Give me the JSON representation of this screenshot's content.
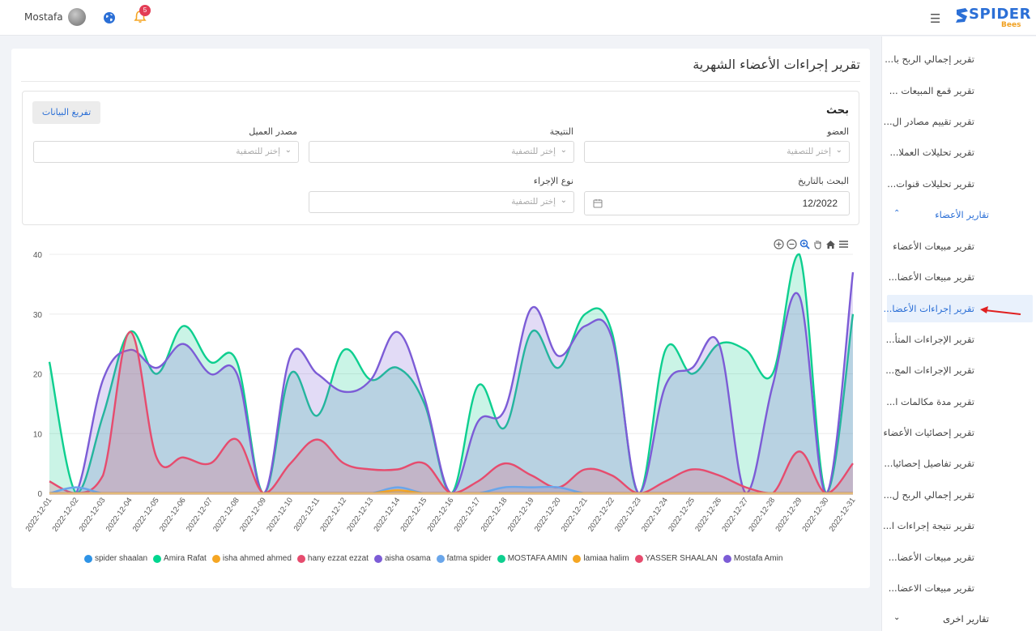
{
  "header": {
    "user_name": "Mostafa",
    "notification_count": "5",
    "logo_word": "SPIDER",
    "logo_sub": "Bees"
  },
  "sidebar": {
    "items_top": [
      "تقرير إجمالي الربح با...",
      "تقرير قمع المبيعات ...",
      "تقرير تقييم مصادر ال...",
      "تقرير تحليلات العملا...",
      "تقرير تحليلات قنوات..."
    ],
    "group_members": "تقارير الأعضاء",
    "items_members": [
      "تقرير مبيعات الأعضاء",
      "تقرير مبيعات الأعضا...",
      "تقرير إجراءات الأعضا...",
      "تقرير الإجراءات المتأ...",
      "تقرير الإجراءات المج...",
      "تقرير مدة مكالمات ا...",
      "تقرير إحصائيات الأعضاء",
      "تقرير تفاصيل إحصائيا...",
      "تقرير إجمالي الربح ل...",
      "تقرير نتيجة إجراءات ا...",
      "تقرير مبيعات الأعضا...",
      "تقرير مبيعات الاعضا..."
    ],
    "active_index": 2,
    "group_other": "تقارير اخرى"
  },
  "page": {
    "title": "تقرير إجراءات الأعضاء الشهرية",
    "search_title": "بحث",
    "export_label": "تفريغ البيانات",
    "filters": {
      "member_label": "العضو",
      "result_label": "النتيجة",
      "source_label": "مصدر العميل",
      "date_label": "البحث بالتاريخ",
      "action_type_label": "نوع الإجراء",
      "placeholder": "إختر للتصفية",
      "date_value": "12/2022"
    }
  },
  "colors": {
    "accent": "#2b6fd6",
    "mostafa_amin": "#7c5cd6",
    "mostafa_amin_upper": "#0ecf8f",
    "hany": "#e64c6e",
    "fatma": "#6aa6ea"
  },
  "chart_data": {
    "type": "area",
    "x": [
      "2022-12-01",
      "2022-12-02",
      "2022-12-03",
      "2022-12-04",
      "2022-12-05",
      "2022-12-06",
      "2022-12-07",
      "2022-12-08",
      "2022-12-09",
      "2022-12-10",
      "2022-12-11",
      "2022-12-12",
      "2022-12-13",
      "2022-12-14",
      "2022-12-15",
      "2022-12-16",
      "2022-12-17",
      "2022-12-18",
      "2022-12-19",
      "2022-12-20",
      "2022-12-21",
      "2022-12-22",
      "2022-12-23",
      "2022-12-24",
      "2022-12-25",
      "2022-12-26",
      "2022-12-27",
      "2022-12-28",
      "2022-12-29",
      "2022-12-30",
      "2022-12-31"
    ],
    "ylim": [
      0,
      40
    ],
    "yticks": [
      0,
      10,
      20,
      30,
      40
    ],
    "grid": true,
    "legend_position": "bottom",
    "series": [
      {
        "name": "spider shaalan",
        "color": "#2e93e6",
        "values": [
          0,
          0,
          0,
          0,
          0,
          0,
          0,
          0,
          0,
          0,
          0,
          0,
          0,
          0,
          0,
          0,
          0,
          0,
          0,
          0,
          0,
          0,
          0,
          0,
          0,
          0,
          0,
          0,
          0,
          0,
          0
        ]
      },
      {
        "name": "Amira Rafat",
        "color": "#00d68f",
        "values": [
          0,
          0,
          0,
          0,
          0,
          0,
          0,
          0,
          0,
          0,
          0,
          0,
          0,
          0,
          0,
          0,
          0,
          0,
          0,
          0,
          0,
          0,
          0,
          0,
          0,
          0,
          0,
          0,
          0,
          0,
          0
        ]
      },
      {
        "name": "isha ahmed ahmed",
        "color": "#f5a623",
        "values": [
          0,
          0,
          0,
          0,
          0,
          0,
          0,
          0,
          0,
          0,
          0,
          0,
          0,
          0.5,
          0,
          0,
          0,
          0,
          0,
          0,
          0,
          0,
          0,
          0,
          0,
          0,
          0,
          0,
          0,
          0,
          0
        ]
      },
      {
        "name": "hany ezzat ezzat",
        "color": "#e64c6e",
        "values": [
          0,
          0,
          0,
          0,
          0,
          0,
          0,
          0,
          0,
          0,
          0,
          0,
          0,
          0,
          0,
          0,
          0,
          0,
          0,
          0,
          0,
          0,
          0,
          0,
          0,
          0,
          0,
          0,
          0,
          0,
          0
        ]
      },
      {
        "name": "aisha osama",
        "color": "#7c5cd6",
        "values": [
          0,
          0,
          0,
          0,
          0,
          0,
          0,
          0,
          0,
          0,
          0,
          0,
          0,
          0,
          0,
          0,
          0,
          0,
          0,
          0,
          0,
          0,
          0,
          0,
          0,
          0,
          0,
          0,
          0,
          0,
          0
        ]
      },
      {
        "name": "fatma spider",
        "color": "#6aa6ea",
        "values": [
          0,
          1,
          0,
          0,
          0,
          0,
          0,
          0,
          0,
          0,
          0,
          0,
          0,
          1,
          0,
          0,
          0,
          1,
          1,
          1,
          0,
          0,
          0,
          0,
          0,
          0,
          0,
          0,
          0,
          0,
          0
        ]
      },
      {
        "name": "MOSTAFA AMIN",
        "color": "#0ecf8f",
        "values": [
          22,
          0,
          13,
          27,
          20,
          28,
          22,
          22,
          0,
          20,
          13,
          24,
          19,
          21,
          15,
          0,
          18,
          11,
          27,
          21,
          30,
          27,
          0,
          24,
          20,
          25,
          24,
          20,
          40,
          0,
          30
        ]
      },
      {
        "name": "lamiaa halim",
        "color": "#f5a623",
        "values": [
          0,
          0,
          0,
          0,
          0,
          0,
          0,
          0,
          0,
          0,
          0,
          0,
          0,
          0,
          0,
          0,
          0,
          0,
          0,
          0,
          0,
          0,
          0,
          0,
          0,
          0,
          0,
          0,
          0,
          0,
          0
        ]
      },
      {
        "name": "YASSER SHAALAN",
        "color": "#e64c6e",
        "values": [
          2,
          0,
          3,
          27,
          6,
          6,
          5,
          9,
          0,
          5,
          9,
          5,
          4,
          4,
          5,
          0,
          2,
          5,
          3,
          1,
          4,
          3,
          0,
          2,
          4,
          3,
          1,
          0,
          7,
          0,
          5
        ]
      },
      {
        "name": "Mostafa Amin",
        "color": "#7c5cd6",
        "values": [
          0,
          0,
          19,
          24,
          21,
          25,
          20,
          20,
          0,
          23,
          20,
          17,
          19,
          27,
          16,
          0,
          12,
          14,
          31,
          23,
          28,
          26,
          0,
          18,
          21,
          25,
          0,
          18,
          33,
          0,
          37
        ]
      }
    ]
  }
}
